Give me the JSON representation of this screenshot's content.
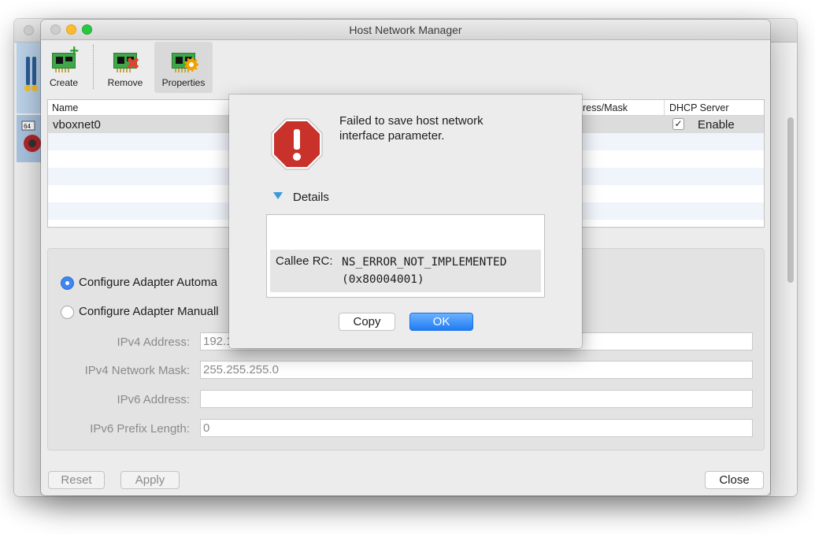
{
  "window": {
    "title": "Host Network Manager"
  },
  "toolbar": {
    "create_label": "Create",
    "remove_label": "Remove",
    "properties_label": "Properties"
  },
  "table": {
    "columns": [
      "Name",
      "ress/Mask",
      "DHCP Server"
    ],
    "rows": [
      {
        "name": "vboxnet0",
        "dhcp_checked": true,
        "dhcp_label": "Enable"
      }
    ]
  },
  "form": {
    "auto_label": "Configure Adapter Automa",
    "manual_label": "Configure Adapter Manuall",
    "fields": [
      {
        "label": "IPv4 Address:",
        "value": "192.1"
      },
      {
        "label": "IPv4 Network Mask:",
        "value": "255.255.255.0"
      },
      {
        "label": "IPv6 Address:",
        "value": ""
      },
      {
        "label": "IPv6 Prefix Length:",
        "value": "0"
      }
    ]
  },
  "footer": {
    "reset_label": "Reset",
    "apply_label": "Apply",
    "close_label": "Close"
  },
  "dialog": {
    "message": "Failed to save host network interface parameter.",
    "details_label": "Details",
    "callee_label": "Callee RC:",
    "callee_value_line1": "NS_ERROR_NOT_IMPLEMENTED",
    "callee_value_line2": "(0x80004001)",
    "copy_label": "Copy",
    "ok_label": "OK"
  },
  "background_vm": {
    "badge": "64"
  },
  "colors": {
    "accent": "#1f7cf5",
    "error_red": "#c8322b",
    "selection_gray": "#dcdcdc"
  }
}
